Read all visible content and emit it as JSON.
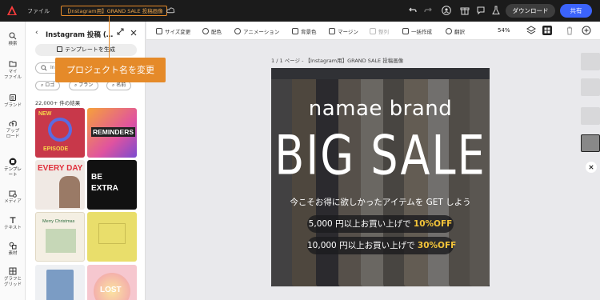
{
  "topbar": {
    "file_label": "ファイル",
    "project_name": "【Instagram用】GRAND SALE 投稿画像",
    "download_label": "ダウンロード",
    "share_label": "共有"
  },
  "callout": {
    "text": "プロジェクト名を変更"
  },
  "rail": {
    "items": [
      {
        "label": "検索"
      },
      {
        "label": "マイ\nファイル"
      },
      {
        "label": "ブランド"
      },
      {
        "label": "アップ\nロード"
      },
      {
        "label": "テンプレ\nート"
      },
      {
        "label": "メディア"
      },
      {
        "label": "テキスト"
      },
      {
        "label": "素材"
      },
      {
        "label": "グラフと\nグリッド"
      }
    ]
  },
  "panel": {
    "back": "‹",
    "title": "Instagram 投稿 (…",
    "generate_label": "テンプレートを生成",
    "search_placeholder": "In",
    "chips": [
      "ロゴ",
      "ブラン",
      "名前"
    ],
    "result_count": "22,000+ 件の結果",
    "thumbs": [
      {
        "line1": "NEW",
        "line2": "EPISODE"
      },
      {
        "line1": "REMINDERS",
        "line2": ""
      },
      {
        "line1": "EVERY DAY",
        "line2": ""
      },
      {
        "line1": "BE",
        "line2": "EXTRA"
      },
      {
        "line1": "Merry Christmas",
        "line2": ""
      },
      {
        "line1": "",
        "line2": ""
      },
      {
        "line1": "",
        "line2": ""
      },
      {
        "line1": "LOST",
        "line2": ""
      }
    ]
  },
  "toolbar": {
    "items": [
      "サイズ変更",
      "配色",
      "アニメーション",
      "背景色",
      "マージン",
      "整列",
      "一括作成",
      "翻訳"
    ],
    "zoom": "54%"
  },
  "canvas": {
    "page_label": "1 / 1 ページ - 【Instagram用】GRAND SALE 投稿画像",
    "brand": "namae brand",
    "headline": "BIG SALE",
    "subline": "今こそお得に欲しかったアイテムを GET しよう",
    "offer1_pre": "5,000 円以上お買い上げで ",
    "offer1_hl": "10%OFF",
    "offer2_pre": "10,000 円以上お買い上げで ",
    "offer2_hl": "30%OFF"
  },
  "colors": {
    "accent": "#e58a29",
    "share": "#3b63fb",
    "highlight": "#f3c43a"
  }
}
